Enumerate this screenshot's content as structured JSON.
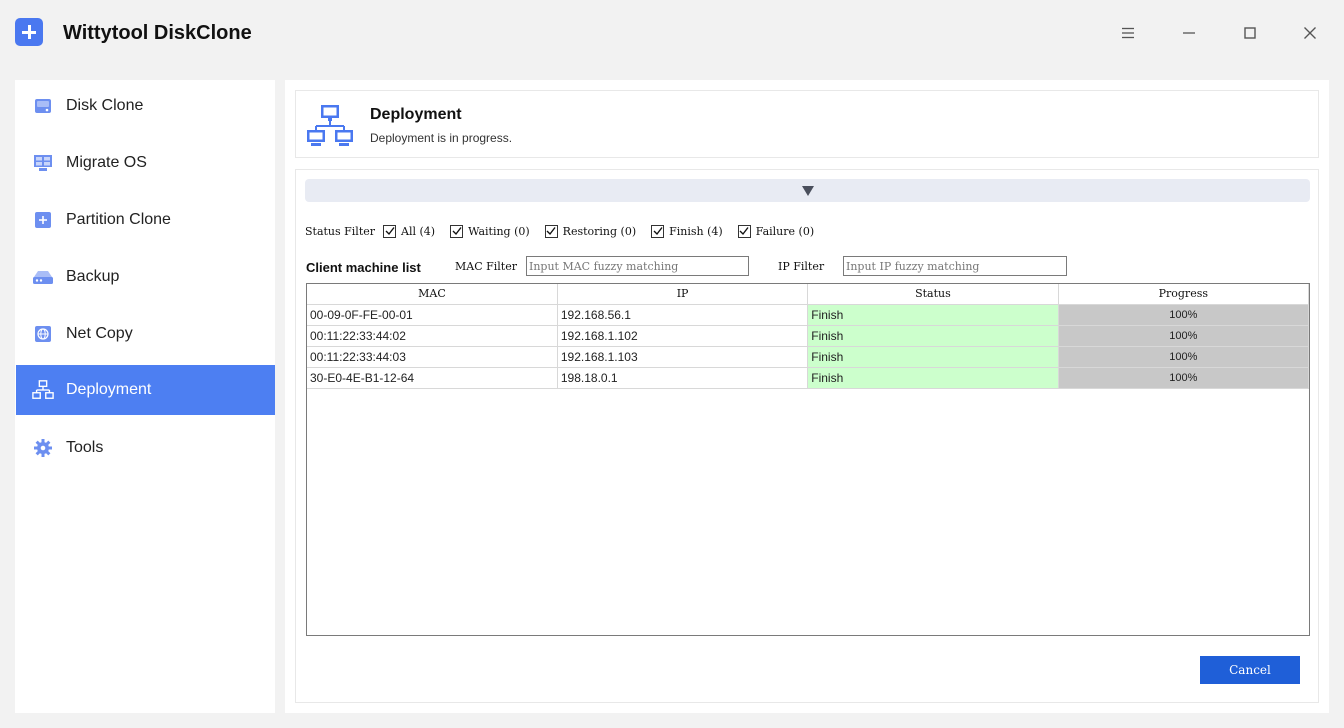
{
  "app": {
    "title": "Wittytool DiskClone"
  },
  "window_controls": {
    "menu_icon": "menu-icon",
    "minimize_icon": "minimize-icon",
    "maximize_icon": "maximize-icon",
    "close_icon": "close-icon"
  },
  "sidebar": {
    "items": [
      {
        "label": "Disk Clone",
        "icon": "disk-icon",
        "active": false
      },
      {
        "label": "Migrate OS",
        "icon": "migrate-icon",
        "active": false
      },
      {
        "label": "Partition Clone",
        "icon": "partition-icon",
        "active": false
      },
      {
        "label": "Backup",
        "icon": "backup-icon",
        "active": false
      },
      {
        "label": "Net Copy",
        "icon": "globe-icon",
        "active": false
      },
      {
        "label": "Deployment",
        "icon": "network-icon",
        "active": true
      },
      {
        "label": "Tools",
        "icon": "gear-icon",
        "active": false
      }
    ]
  },
  "header": {
    "title": "Deployment",
    "subtitle": "Deployment is in progress."
  },
  "filters": {
    "status_label": "Status Filter",
    "status_options": [
      {
        "label": "All (4)",
        "checked": true
      },
      {
        "label": "Waiting (0)",
        "checked": true
      },
      {
        "label": "Restoring (0)",
        "checked": true
      },
      {
        "label": "Finish (4)",
        "checked": true
      },
      {
        "label": "Failure (0)",
        "checked": true
      }
    ],
    "list_label": "Client machine list",
    "mac_label": "MAC Filter",
    "mac_placeholder": "Input MAC fuzzy matching",
    "mac_value": "",
    "ip_label": "IP Filter",
    "ip_placeholder": "Input IP fuzzy matching",
    "ip_value": ""
  },
  "table": {
    "columns": [
      "MAC",
      "IP",
      "Status",
      "Progress"
    ],
    "rows": [
      {
        "mac": "00-09-0F-FE-00-01",
        "ip": "192.168.56.1",
        "status": "Finish",
        "progress": "100%"
      },
      {
        "mac": "00:11:22:33:44:02",
        "ip": "192.168.1.102",
        "status": "Finish",
        "progress": "100%"
      },
      {
        "mac": "00:11:22:33:44:03",
        "ip": "192.168.1.103",
        "status": "Finish",
        "progress": "100%"
      },
      {
        "mac": "30-E0-4E-B1-12-64",
        "ip": "198.18.0.1",
        "status": "Finish",
        "progress": "100%"
      }
    ]
  },
  "actions": {
    "cancel_label": "Cancel"
  },
  "colors": {
    "accent": "#4d7ff2",
    "finish_bg": "#ccffcc",
    "progress_bg": "#c8c8c8",
    "cancel_bg": "#1f5fd8"
  }
}
